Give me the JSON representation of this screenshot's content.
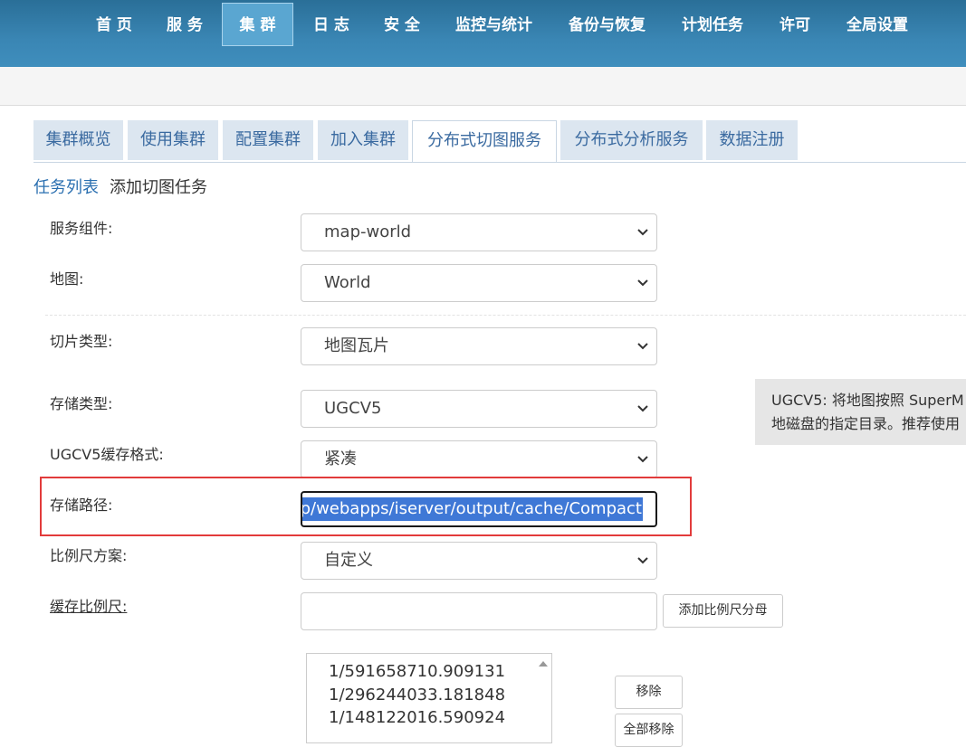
{
  "nav": {
    "items": [
      "首 页",
      "服 务",
      "集 群",
      "日 志",
      "安 全",
      "监控与统计",
      "备份与恢复",
      "计划任务",
      "许可",
      "全局设置"
    ],
    "active_index": 2
  },
  "tabs": {
    "items": [
      "集群概览",
      "使用集群",
      "配置集群",
      "加入集群",
      "分布式切图服务",
      "分布式分析服务",
      "数据注册"
    ],
    "active_index": 4
  },
  "breadcrumb": {
    "link": "任务列表",
    "current": "添加切图任务"
  },
  "form": {
    "service_component": {
      "label": "服务组件:",
      "value": "map-world"
    },
    "map": {
      "label": "地图:",
      "value": "World"
    },
    "tile_type": {
      "label": "切片类型:",
      "value": "地图瓦片"
    },
    "storage_type": {
      "label": "存储类型:",
      "value": "UGCV5"
    },
    "cache_format": {
      "label": "UGCV5缓存格式:",
      "value": "紧凑"
    },
    "storage_path": {
      "label": "存储路径:",
      "value": "p/webapps/iserver/output/cache/Compact"
    },
    "scale_scheme": {
      "label": "比例尺方案:",
      "value": "自定义"
    },
    "cache_scales": {
      "label": "缓存比例尺:",
      "value": "",
      "add_button": "添加比例尺分母",
      "list": [
        "1/591658710.909131",
        "1/296244033.181848",
        "1/148122016.590924"
      ],
      "remove_button": "移除",
      "remove_all_button": "全部移除"
    }
  },
  "tooltip": {
    "line1": "UGCV5: 将地图按照 SuperM",
    "line2": "地磁盘的指定目录。推荐使用"
  },
  "colors": {
    "nav_bg": "#3a86b4",
    "tab_bg": "#dce6f0",
    "link": "#2a6fb0",
    "selection": "#3f78d6",
    "highlight_box": "#e23b3b"
  }
}
